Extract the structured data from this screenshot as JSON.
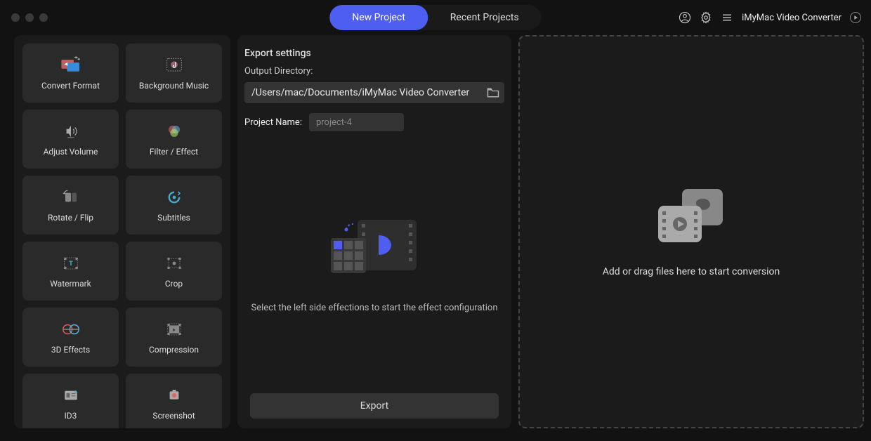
{
  "header": {
    "tabs": {
      "new": "New Project",
      "recent": "Recent Projects"
    },
    "app_name": "iMyMac Video Converter"
  },
  "sidebar": {
    "tiles": [
      {
        "id": "convert-format",
        "label": "Convert Format"
      },
      {
        "id": "background-music",
        "label": "Background Music"
      },
      {
        "id": "adjust-volume",
        "label": "Adjust Volume"
      },
      {
        "id": "filter-effect",
        "label": "Filter / Effect"
      },
      {
        "id": "rotate-flip",
        "label": "Rotate / Flip"
      },
      {
        "id": "subtitles",
        "label": "Subtitles"
      },
      {
        "id": "watermark",
        "label": "Watermark"
      },
      {
        "id": "crop",
        "label": "Crop"
      },
      {
        "id": "3d-effects",
        "label": "3D Effects"
      },
      {
        "id": "compression",
        "label": "Compression"
      },
      {
        "id": "id3",
        "label": "ID3"
      },
      {
        "id": "screenshot",
        "label": "Screenshot"
      }
    ]
  },
  "export": {
    "title": "Export settings",
    "dir_label": "Output Directory:",
    "dir_value": "/Users/mac/Documents/iMyMac Video Converter",
    "name_label": "Project Name:",
    "name_placeholder": "project-4",
    "hint": "Select the left side effections to start the effect configuration",
    "button": "Export"
  },
  "drop": {
    "hint": "Add or drag files here to start conversion"
  }
}
